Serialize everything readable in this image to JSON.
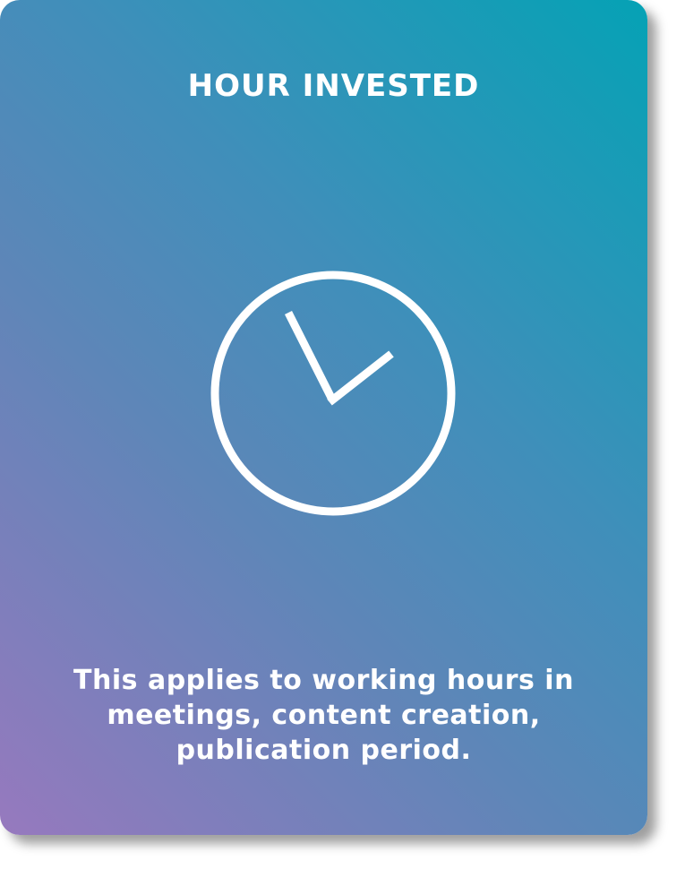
{
  "card": {
    "title": "HOUR INVESTED",
    "icon": "clock-icon",
    "description_lines": [
      "This applies to working hours in",
      "meetings, content creation,",
      "publication period."
    ],
    "colors": {
      "gradient_start": "#9779be",
      "gradient_end": "#05a2b5",
      "text": "#ffffff"
    }
  }
}
